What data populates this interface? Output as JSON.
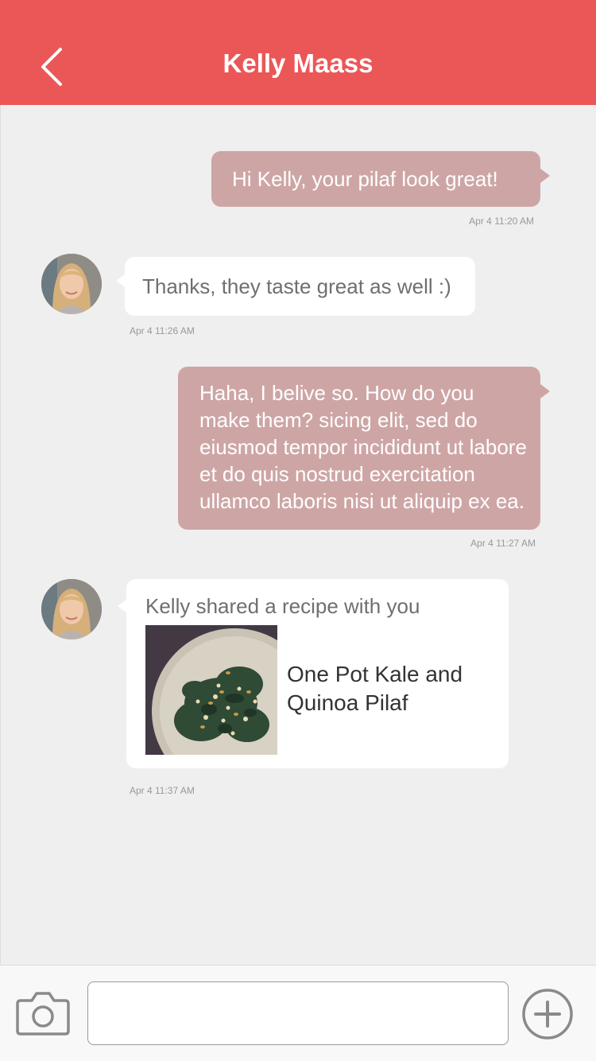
{
  "header": {
    "title": "Kelly Maass",
    "back_icon": "chevron-left-icon",
    "background": "#eb5757"
  },
  "colors": {
    "outgoing_bubble": "#cea5a5",
    "incoming_bubble": "#ffffff",
    "chat_background": "#efefef"
  },
  "messages": [
    {
      "direction": "outgoing",
      "text": "Hi Kelly, your pilaf look great!",
      "time": "Apr 4 11:20 AM"
    },
    {
      "direction": "incoming",
      "text": "Thanks, they taste great as well :)",
      "time": "Apr 4 11:26 AM"
    },
    {
      "direction": "outgoing",
      "text": "Haha, I belive so. How do you make them?  sicing elit, sed do eiusmod tempor incididunt ut labore et do quis nostrud exercitation ullamco laboris nisi ut aliquip ex ea.",
      "time": "Apr 4 11:27 AM"
    },
    {
      "direction": "incoming",
      "type": "recipe",
      "caption": "Kelly shared a recipe with you",
      "recipe_title": "One Pot Kale and Quinoa Pilaf",
      "time": "Apr 4 11:37 AM"
    }
  ],
  "composer": {
    "camera_icon": "camera-icon",
    "input_value": "",
    "add_icon": "plus-circle-icon"
  }
}
